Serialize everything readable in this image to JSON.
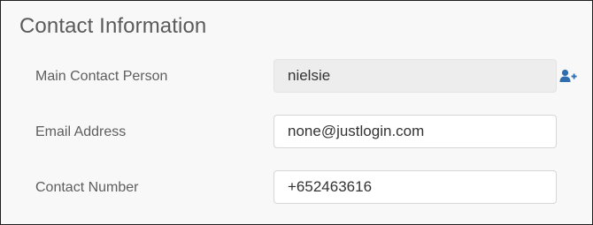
{
  "section": {
    "title": "Contact Information"
  },
  "fields": {
    "main_contact": {
      "label": "Main Contact Person",
      "value": "nielsie"
    },
    "email": {
      "label": "Email Address",
      "value": "none@justlogin.com"
    },
    "phone": {
      "label": "Contact Number",
      "value": "+652463616"
    }
  },
  "icons": {
    "add_contact": "user-plus-icon"
  },
  "colors": {
    "accent": "#2f6fb0",
    "readonly_bg": "#ededed",
    "panel_bg": "#f8f8f8"
  }
}
